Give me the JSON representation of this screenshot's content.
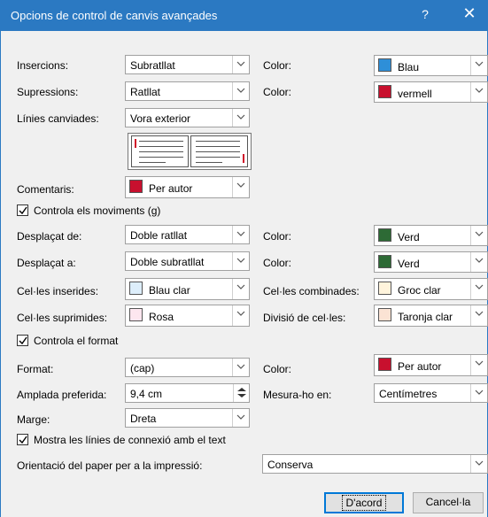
{
  "window": {
    "title": "Opcions de control de canvis avançades",
    "help_glyph": "?",
    "close_glyph": "✕"
  },
  "markup": {
    "insertions": {
      "label": "Insercions:",
      "value": "Subratllat",
      "color_label": "Color:",
      "color_value": "Blau",
      "swatch": "#2e8fd8"
    },
    "deletions": {
      "label": "Supressions:",
      "value": "Ratllat",
      "color_label": "Color:",
      "color_value": "vermell",
      "swatch": "#c8102e"
    },
    "changed_lines": {
      "label": "Línies canviades:",
      "value": "Vora exterior"
    },
    "comments": {
      "label": "Comentaris:",
      "value": "Per autor",
      "swatch": "#c8102e"
    }
  },
  "moves": {
    "checkbox_label": "Controla els moviments (g)",
    "checked": true,
    "moved_from": {
      "label": "Desplaçat de:",
      "value": "Doble ratllat",
      "color_label": "Color:",
      "color_value": "Verd",
      "swatch": "#2d6a35"
    },
    "moved_to": {
      "label": "Desplaçat a:",
      "value": "Doble subratllat",
      "color_label": "Color:",
      "color_value": "Verd",
      "swatch": "#2d6a35"
    }
  },
  "table": {
    "inserted": {
      "label": "Cel·les inserides:",
      "value": "Blau clar",
      "swatch": "#ddeefb"
    },
    "merged": {
      "label": "Cel·les combinades:",
      "value": "Groc clar",
      "swatch": "#fff4dc"
    },
    "deleted": {
      "label": "Cel·les suprimides:",
      "value": "Rosa",
      "swatch": "#fde6ef"
    },
    "split": {
      "label": "Divisió de cel·les:",
      "value": "Taronja clar",
      "swatch": "#fbe3d4"
    }
  },
  "formatting": {
    "checkbox_label": "Controla el format",
    "checked": true,
    "format": {
      "label": "Format:",
      "value": "(cap)",
      "color_label": "Color:",
      "color_value": "Per autor",
      "swatch": "#c8102e"
    }
  },
  "balloons": {
    "preferred_width": {
      "label": "Amplada preferida:",
      "value": "9,4 cm"
    },
    "measure_in": {
      "label": "Mesura-ho en:",
      "value": "Centímetres"
    },
    "margin": {
      "label": "Marge:",
      "value": "Dreta"
    },
    "show_lines": {
      "label": "Mostra les línies de connexió amb el text",
      "checked": true
    },
    "orientation": {
      "label": "Orientació del paper per a la impressió:",
      "value": "Conserva"
    }
  },
  "buttons": {
    "ok": "D'acord",
    "cancel": "Cancel·la"
  }
}
